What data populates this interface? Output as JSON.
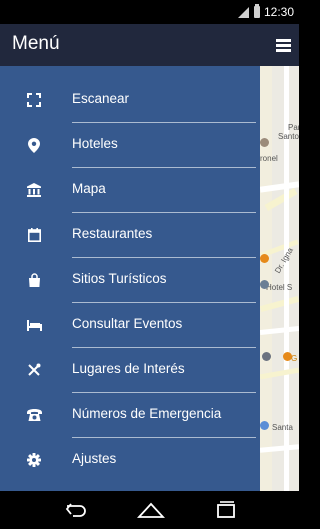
{
  "status_bar": {
    "time": "12:30",
    "icons": [
      "signal-icon",
      "battery-icon"
    ]
  },
  "toolbar": {
    "title": "Menú",
    "menu_icon": "hamburger-icon"
  },
  "menu": {
    "items": [
      {
        "label": "Escanear",
        "icon": "scan-icon"
      },
      {
        "label": "Hoteles",
        "icon": "location-pin-icon"
      },
      {
        "label": "Mapa",
        "icon": "museum-icon"
      },
      {
        "label": "Restaurantes",
        "icon": "calendar-icon"
      },
      {
        "label": "Sitios Turísticos",
        "icon": "shopping-bag-icon"
      },
      {
        "label": "Consultar Eventos",
        "icon": "bed-icon"
      },
      {
        "label": "Lugares de Interés",
        "icon": "utensils-icon"
      },
      {
        "label": "Números de Emergencia",
        "icon": "telephone-icon"
      },
      {
        "label": "Ajustes",
        "icon": "gear-icon"
      }
    ]
  },
  "map_labels": {
    "l1": "Parro",
    "l2": "Santo Do",
    "l3": "ronel",
    "l4": "Dr. Igna",
    "l5": "Hotel S",
    "l6": "G",
    "l7": "Santa"
  },
  "colors": {
    "drawer": "#36598e",
    "toolbar": "#21283d",
    "map": "#eceae3"
  }
}
